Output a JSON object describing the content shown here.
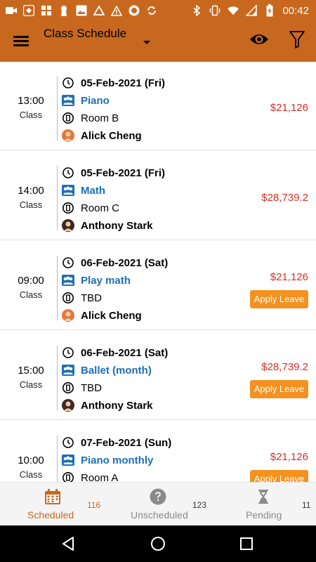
{
  "status_bar": {
    "time": "00:42",
    "left_icons": [
      "video-icon",
      "app-icon",
      "chinese-app-icon",
      "keyhole-icon",
      "image-icon",
      "drive-icon",
      "warning-icon",
      "circle-app-icon",
      "sync-icon"
    ],
    "right_icons": [
      "bluetooth-icon",
      "vibrate-icon",
      "wifi-icon",
      "signal-icon",
      "battery-charging-icon"
    ]
  },
  "app_bar": {
    "title": "Class Schedule",
    "background": "#c8681e"
  },
  "schedule": [
    {
      "time": "13:00",
      "kind": "Class",
      "date": "05-Feb-2021 (Fri)",
      "course": "Piano",
      "room": "Room B",
      "teacher": "Alick Cheng",
      "price": "$21,126",
      "apply_label": ""
    },
    {
      "time": "14:00",
      "kind": "Class",
      "date": "05-Feb-2021 (Fri)",
      "course": "Math",
      "room": "Room C",
      "teacher": "Anthony Stark",
      "price": "$28,739.2",
      "apply_label": ""
    },
    {
      "time": "09:00",
      "kind": "Class",
      "date": "06-Feb-2021 (Sat)",
      "course": "Play math",
      "room": "TBD",
      "teacher": "Alick Cheng",
      "price": "$21,126",
      "apply_label": "Apply Leave"
    },
    {
      "time": "15:00",
      "kind": "Class",
      "date": "06-Feb-2021 (Sat)",
      "course": "Ballet (month)",
      "room": "TBD",
      "teacher": "Anthony Stark",
      "price": "$28,739.2",
      "apply_label": "Apply Leave"
    },
    {
      "time": "10:00",
      "kind": "Class",
      "date": "07-Feb-2021 (Sun)",
      "course": "Piano monthly",
      "room": "Room A",
      "teacher": "",
      "price": "$21,126",
      "apply_label": "Apply Leave"
    }
  ],
  "bottom_nav": {
    "tabs": [
      {
        "label": "Scheduled",
        "count": "116",
        "icon": "calendar-icon",
        "active": true
      },
      {
        "label": "Unscheduled",
        "count": "123",
        "icon": "help-circle-icon",
        "active": false
      },
      {
        "label": "Pending",
        "count": "11",
        "icon": "hourglass-icon",
        "active": false
      }
    ]
  },
  "colors": {
    "accent": "#c8681e",
    "course_link": "#1f6fb4",
    "price": "#d93025",
    "apply_button": "#f3921f"
  }
}
